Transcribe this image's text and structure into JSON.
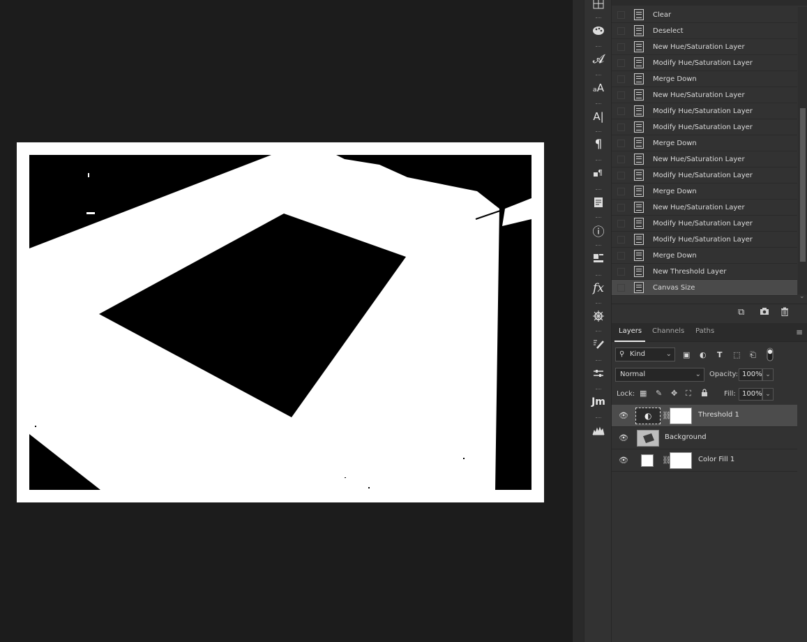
{
  "history": {
    "items": [
      {
        "label": "Clear"
      },
      {
        "label": "Deselect"
      },
      {
        "label": "New Hue/Saturation Layer"
      },
      {
        "label": "Modify Hue/Saturation Layer"
      },
      {
        "label": "Merge Down"
      },
      {
        "label": "New Hue/Saturation Layer"
      },
      {
        "label": "Modify Hue/Saturation Layer"
      },
      {
        "label": "Modify Hue/Saturation Layer"
      },
      {
        "label": "Merge Down"
      },
      {
        "label": "New Hue/Saturation Layer"
      },
      {
        "label": "Modify Hue/Saturation Layer"
      },
      {
        "label": "Merge Down"
      },
      {
        "label": "New Hue/Saturation Layer"
      },
      {
        "label": "Modify Hue/Saturation Layer"
      },
      {
        "label": "Modify Hue/Saturation Layer"
      },
      {
        "label": "Merge Down"
      },
      {
        "label": "New Threshold Layer"
      },
      {
        "label": "Canvas Size"
      }
    ],
    "active_index": 17
  },
  "toolstrip": {
    "tools": [
      "grid-icon",
      "palette-icon",
      "glyph-icon",
      "character-style-icon",
      "type-cursor-icon",
      "paragraph-icon",
      "paragraph-style-icon",
      "notes-icon",
      "info-icon",
      "3d-icon",
      "fx-icon",
      "wheel-icon",
      "brush-settings-icon",
      "properties-icon",
      "jm-icon",
      "histogram-icon"
    ],
    "glyph_label": "𝓐",
    "char_style_label": "ₐA",
    "type_label": "A|",
    "paragraph_label": "¶",
    "info_label": "ⓘ",
    "fx_label": "fx",
    "jm_label": "Jm"
  },
  "layers_panel": {
    "tabs": [
      "Layers",
      "Channels",
      "Paths"
    ],
    "filter_kind": "Kind",
    "blend_mode": "Normal",
    "opacity_label": "Opacity:",
    "opacity_value": "100%",
    "lock_label": "Lock:",
    "fill_label": "Fill:",
    "fill_value": "100%",
    "layers": [
      {
        "name": "Threshold 1",
        "selected": true
      },
      {
        "name": "Background",
        "selected": false
      },
      {
        "name": "Color Fill 1",
        "selected": false
      }
    ]
  },
  "colors": {
    "canvas_bg": "#1c1c1c",
    "panel_bg": "#323232",
    "selected_row": "#4c4c4c"
  }
}
